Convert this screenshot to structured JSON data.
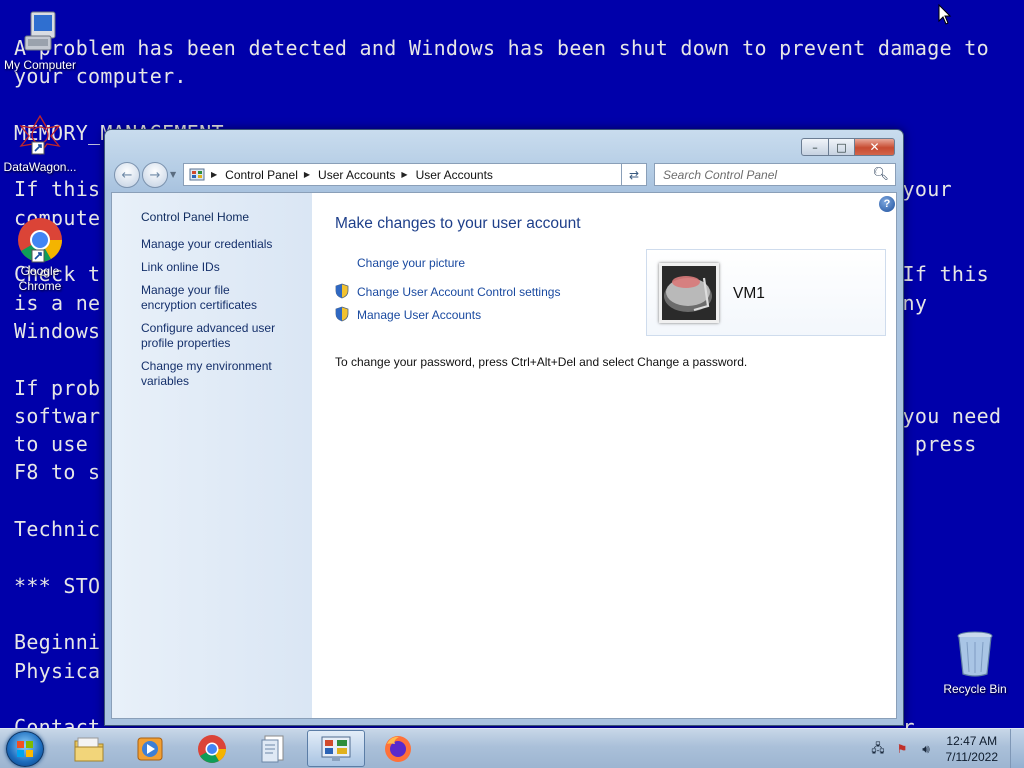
{
  "wallpaper": {
    "text": "A problem has been detected and Windows has been shut down to prevent damage to\nyour computer.\n\nMEMORY_MANAGEMENT\n\nIf this                                                                 your\ncompute\n\nCheck t                                                                 If this\nis a ne                                                                 ny\nWindows\n\nIf prob\nsoftwar                                                                 you need\nto use                                                                 , press\nF8 to s\n\nTechnic\n\n*** STO\n\nBeginni\nPhysica\n\nContact                                                                 r"
  },
  "desktop": {
    "icons": [
      {
        "label": "My Computer"
      },
      {
        "label": "DataWagon..."
      },
      {
        "label": "Google Chrome"
      },
      {
        "label": "Recycle Bin"
      }
    ]
  },
  "window": {
    "address": {
      "crumbs": [
        "Control Panel",
        "User Accounts",
        "User Accounts"
      ]
    },
    "search": {
      "placeholder": "Search Control Panel"
    },
    "left_pane": {
      "home": "Control Panel Home",
      "tasks": [
        "Manage your credentials",
        "Link online IDs",
        "Manage your file encryption certificates",
        "Configure advanced user profile properties",
        "Change my environment variables"
      ]
    },
    "main": {
      "title": "Make changes to your user account",
      "links": [
        "Change your picture",
        "Change User Account Control settings",
        "Manage User Accounts"
      ],
      "password_note": "To change your password, press Ctrl+Alt+Del and select Change a password.",
      "user": {
        "name": "VM1"
      }
    }
  },
  "taskbar": {
    "clock": {
      "time": "12:47 AM",
      "date": "7/11/2022"
    }
  }
}
